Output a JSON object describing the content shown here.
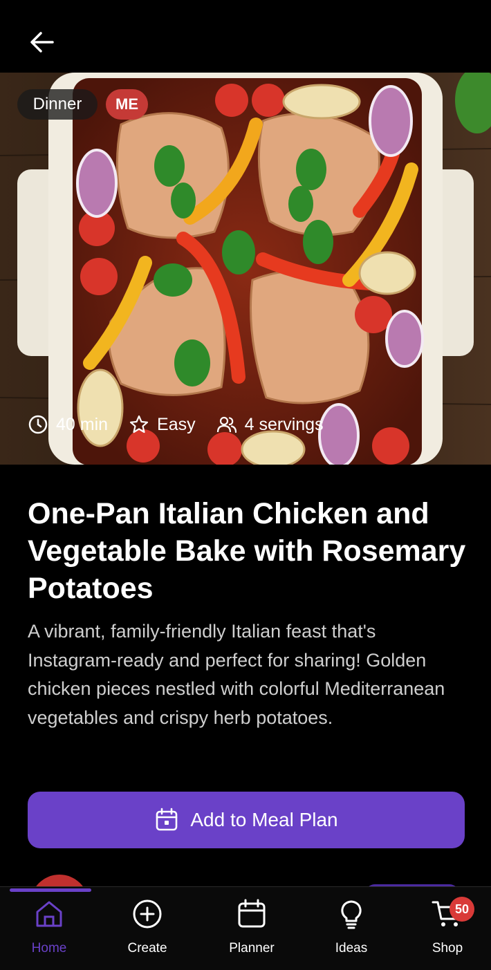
{
  "hero": {
    "tags": [
      "Dinner",
      "ME"
    ],
    "meta": {
      "time": "40 min",
      "difficulty": "Easy",
      "servings": "4 servings"
    }
  },
  "recipe": {
    "title": "One-Pan Italian Chicken and Vegetable Bake with Rosemary Potatoes",
    "description": "A vibrant, family-friendly Italian feast that's Instagram-ready and perfect for sharing! Golden chicken pieces nestled with colorful Mediterranean vegetables and crispy herb potatoes."
  },
  "actions": {
    "add_to_meal_plan": "Add to Meal Plan"
  },
  "nav": {
    "items": [
      {
        "label": "Home",
        "icon": "home-icon",
        "active": true
      },
      {
        "label": "Create",
        "icon": "plus-circle-icon",
        "active": false
      },
      {
        "label": "Planner",
        "icon": "calendar-icon",
        "active": false
      },
      {
        "label": "Ideas",
        "icon": "lightbulb-icon",
        "active": false
      },
      {
        "label": "Shop",
        "icon": "cart-icon",
        "active": false
      }
    ],
    "cart_badge": "50"
  },
  "colors": {
    "accent": "#6a41c8",
    "tag_me": "#c53a36",
    "badge": "#d93a38",
    "background": "#000000"
  }
}
